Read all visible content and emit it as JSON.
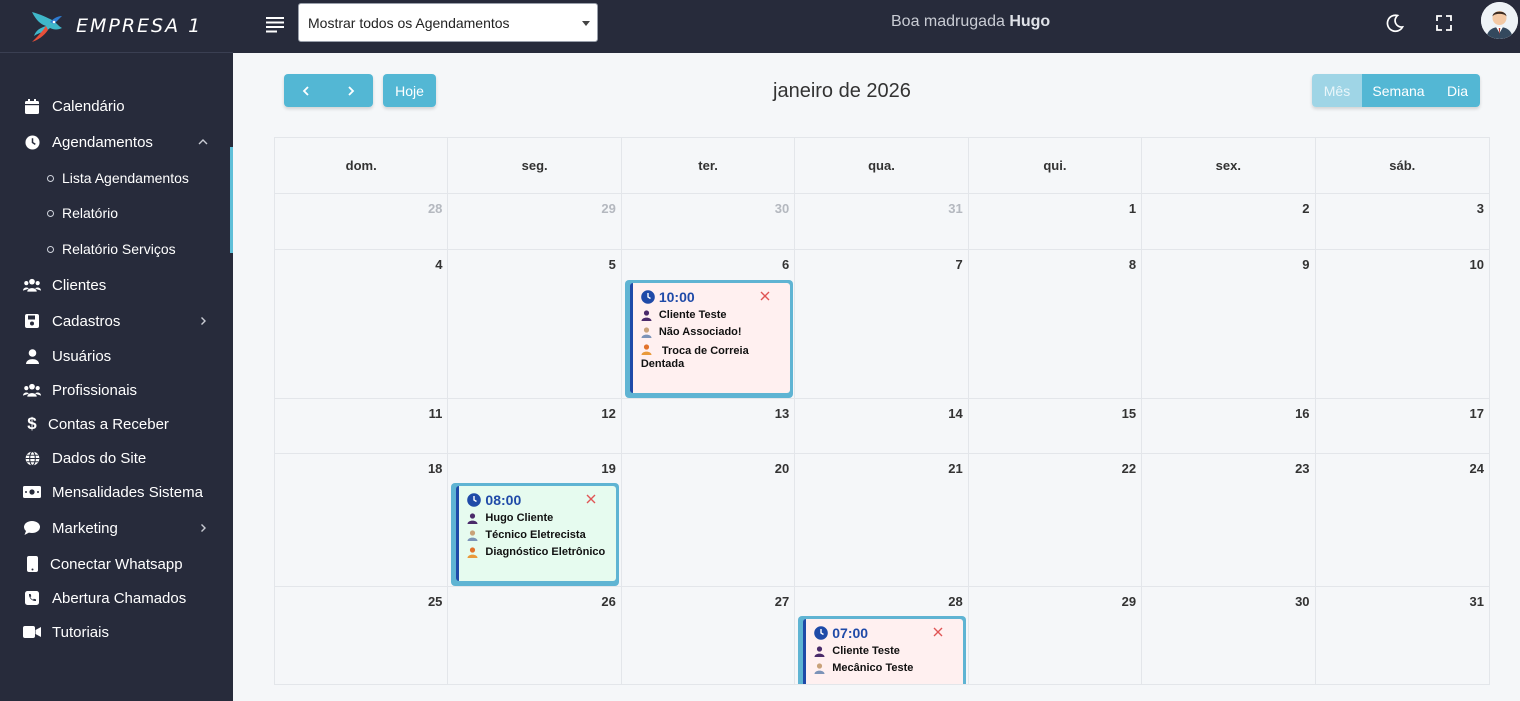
{
  "brand": {
    "name": "EMPRESA 1"
  },
  "sidebar": {
    "items": [
      {
        "label": "Calendário",
        "icon": "calendar-icon"
      },
      {
        "label": "Agendamentos",
        "icon": "clock-icon",
        "expanded": true
      },
      {
        "label": "Clientes",
        "icon": "users-icon"
      },
      {
        "label": "Cadastros",
        "icon": "save-icon"
      },
      {
        "label": "Usuários",
        "icon": "user-icon"
      },
      {
        "label": "Profissionais",
        "icon": "users-icon"
      },
      {
        "label": "Contas a Receber",
        "icon": "dollar-icon"
      },
      {
        "label": "Dados do Site",
        "icon": "globe-icon"
      },
      {
        "label": "Mensalidades Sistema",
        "icon": "money-icon"
      },
      {
        "label": "Marketing",
        "icon": "chat-icon"
      },
      {
        "label": "Conectar Whatsapp",
        "icon": "phone-icon"
      },
      {
        "label": "Abertura Chamados",
        "icon": "call-icon"
      },
      {
        "label": "Tutoriais",
        "icon": "video-icon"
      }
    ],
    "subitems": [
      {
        "label": "Lista Agendamentos"
      },
      {
        "label": "Relatório"
      },
      {
        "label": "Relatório Serviços"
      }
    ]
  },
  "topbar": {
    "filter_value": "Mostrar todos os Agendamentos",
    "greeting": "Boa madrugada",
    "user": "Hugo"
  },
  "toolbar": {
    "today": "Hoje",
    "title": "janeiro de 2026",
    "views": [
      "Mês",
      "Semana",
      "Dia"
    ],
    "active_view": "Mês"
  },
  "calendar": {
    "weekdays": [
      "dom.",
      "seg.",
      "ter.",
      "qua.",
      "qui.",
      "sex.",
      "sáb."
    ],
    "weeks": [
      [
        "28",
        "29",
        "30",
        "31",
        "1",
        "2",
        "3"
      ],
      [
        "4",
        "5",
        "6",
        "7",
        "8",
        "9",
        "10"
      ],
      [
        "11",
        "12",
        "13",
        "14",
        "15",
        "16",
        "17"
      ],
      [
        "18",
        "19",
        "20",
        "21",
        "22",
        "23",
        "24"
      ],
      [
        "25",
        "26",
        "27",
        "28",
        "29",
        "30",
        "31"
      ]
    ]
  },
  "events": [
    {
      "time": "10:00",
      "client": "Cliente Teste",
      "professional": "Não Associado!",
      "service": "Troca de Correia Dentada"
    },
    {
      "time": "08:00",
      "client": "Hugo Cliente",
      "professional": "Técnico Eletrecista",
      "service": "Diagnóstico Eletrônico"
    },
    {
      "time": "07:00",
      "client": "Cliente Teste",
      "professional": "Mecânico Teste"
    }
  ],
  "colors": {
    "sidebar_bg": "#272b3b",
    "accent": "#53b7d4",
    "event_text": "#1f4aa8",
    "close": "#e05555"
  }
}
